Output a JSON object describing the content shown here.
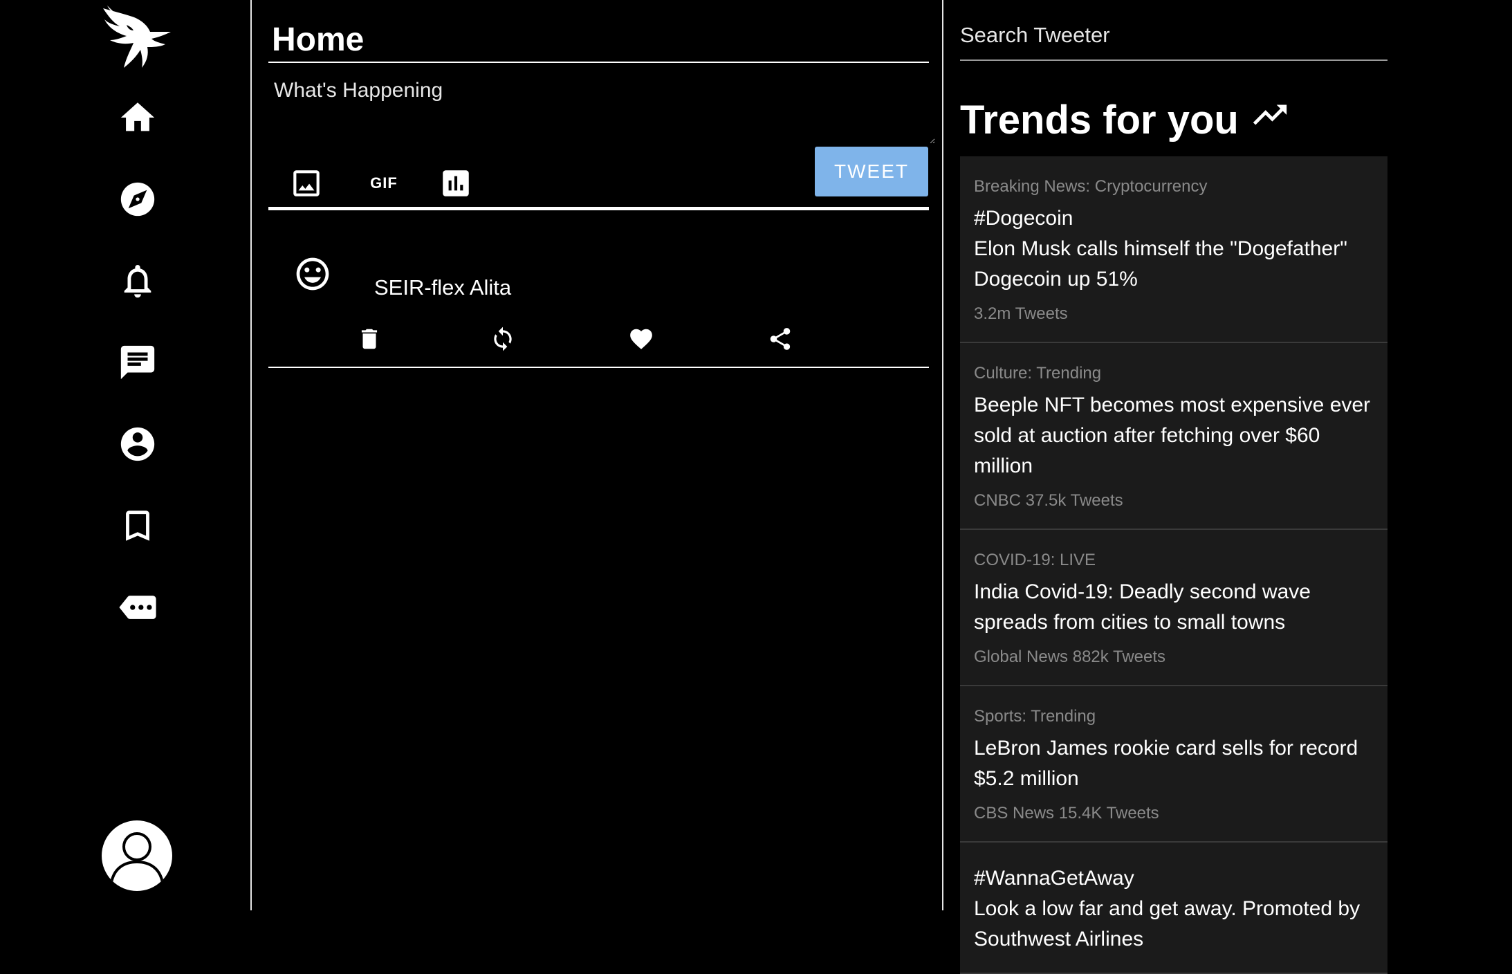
{
  "main": {
    "title": "Home",
    "compose_placeholder": "What's Happening",
    "tools": {
      "gif_label": "GIF"
    },
    "tweet_button": "TWEET"
  },
  "tweets": [
    {
      "text": "SEIR-flex Alita"
    }
  ],
  "right": {
    "search_placeholder": "Search Tweeter",
    "trends_title": "Trends for you",
    "trends": [
      {
        "category": "Breaking News: Cryptocurrency",
        "headline": "#Dogecoin\nElon Musk calls himself the \"Dogefather\" Dogecoin up 51%",
        "count": "3.2m Tweets"
      },
      {
        "category": "Culture: Trending",
        "headline": "Beeple NFT becomes most expensive ever sold at auction after fetching over $60 million",
        "count": "CNBC 37.5k Tweets"
      },
      {
        "category": "COVID-19: LIVE",
        "headline": "India Covid-19: Deadly second wave spreads from cities to small towns",
        "count": "Global News 882k Tweets"
      },
      {
        "category": "Sports: Trending",
        "headline": "LeBron James rookie card sells for record $5.2 million",
        "count": "CBS News 15.4K Tweets"
      },
      {
        "category": "",
        "headline": "#WannaGetAway\nLook a low far and get away. Promoted by Southwest Airlines",
        "count": ""
      }
    ]
  }
}
